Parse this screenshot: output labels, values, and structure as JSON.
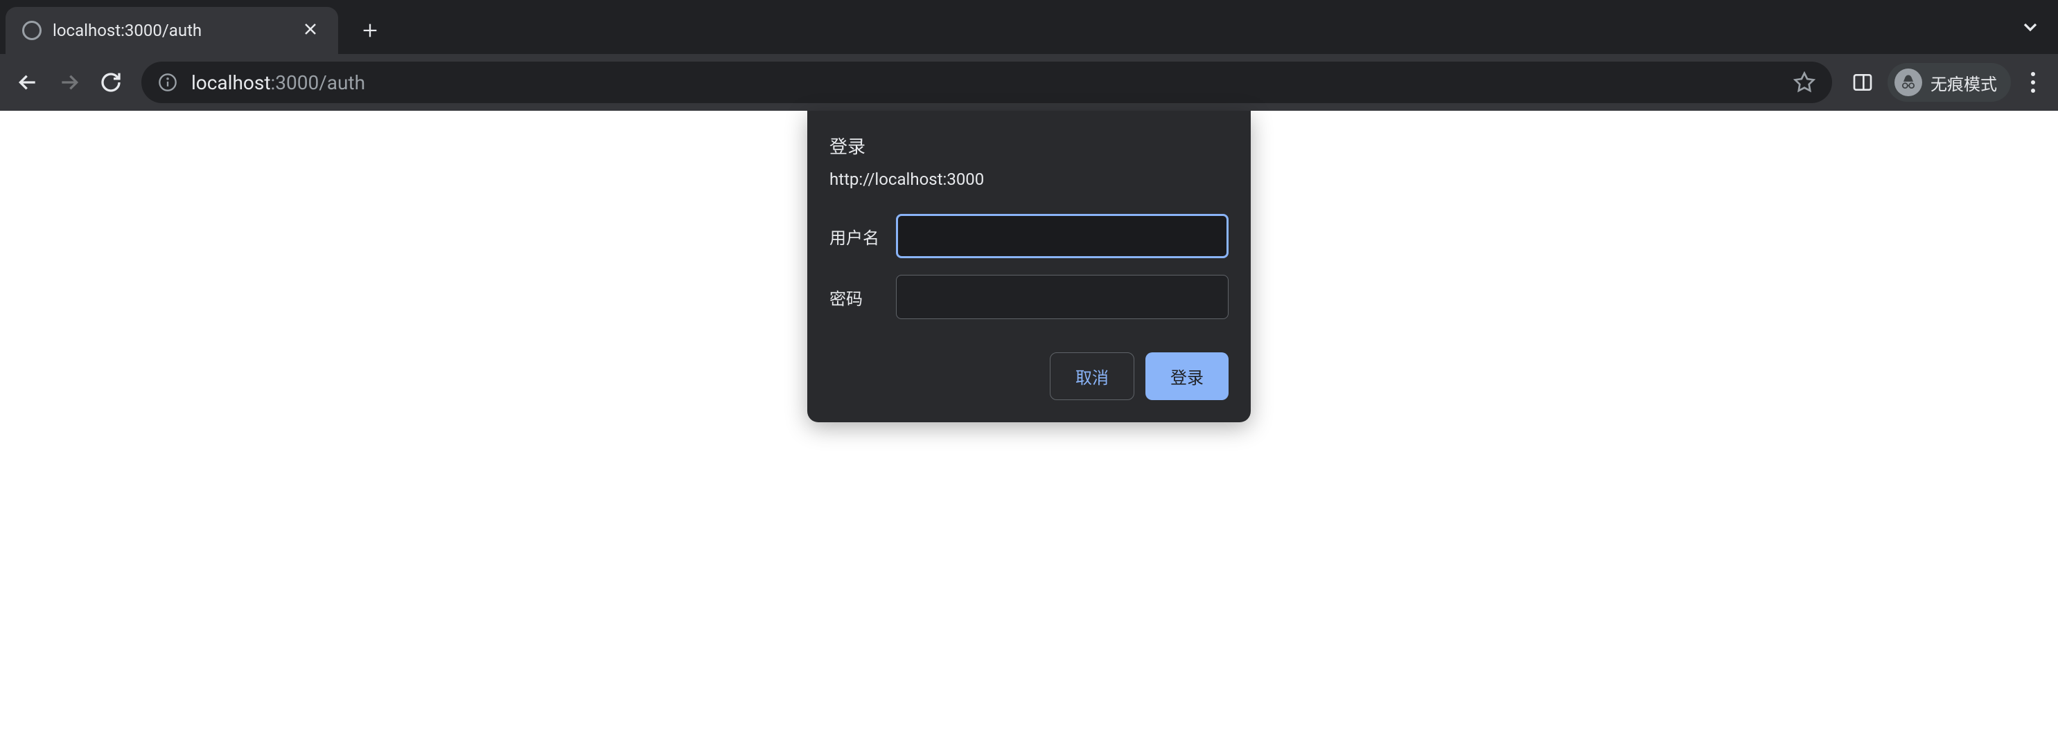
{
  "browser": {
    "tab": {
      "title": "localhost:3000/auth"
    },
    "url": {
      "host": "localhost",
      "path": ":3000/auth"
    },
    "incognito_label": "无痕模式"
  },
  "dialog": {
    "title": "登录",
    "origin": "http://localhost:3000",
    "username_label": "用户名",
    "password_label": "密码",
    "username_value": "",
    "password_value": "",
    "cancel_label": "取消",
    "submit_label": "登录"
  }
}
